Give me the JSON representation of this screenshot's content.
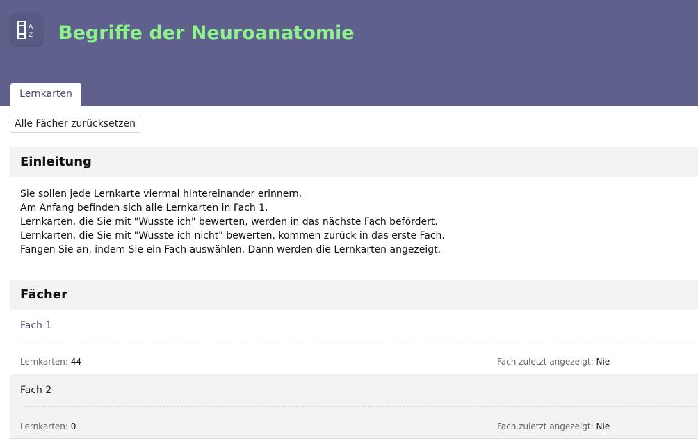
{
  "header": {
    "app_icon": "book-az-icon",
    "title": "Begriffe der Neuroanatomie",
    "title_color": "#8ef08e",
    "background_color": "#5f618c"
  },
  "tabs": [
    {
      "label": "Lernkarten",
      "active": true
    }
  ],
  "reset_button": {
    "label": "Alle Fächer zurücksetzen"
  },
  "intro": {
    "heading": "Einleitung",
    "lines": [
      "Sie sollen jede Lernkarte viermal hintereinander erinnern.",
      "Am Anfang befinden sich alle Lernkarten in Fach 1.",
      "Lernkarten, die Sie mit \"Wusste ich\" bewerten, werden in das nächste Fach befördert.",
      "Lernkarten, die Sie mit \"Wusste ich nicht\" bewerten, kommen zurück in das erste Fach.",
      "Fangen Sie an, indem Sie ein Fach auswählen. Dann werden die Lernkarten angezeigt."
    ]
  },
  "faecher": {
    "heading": "Fächer",
    "count_label": "Lernkarten:",
    "last_shown_label": "Fach zuletzt angezeigt:",
    "items": [
      {
        "name": "Fach 1",
        "count": "44",
        "last_shown": "Nie",
        "link": true
      },
      {
        "name": "Fach 2",
        "count": "0",
        "last_shown": "Nie",
        "link": false
      }
    ]
  }
}
